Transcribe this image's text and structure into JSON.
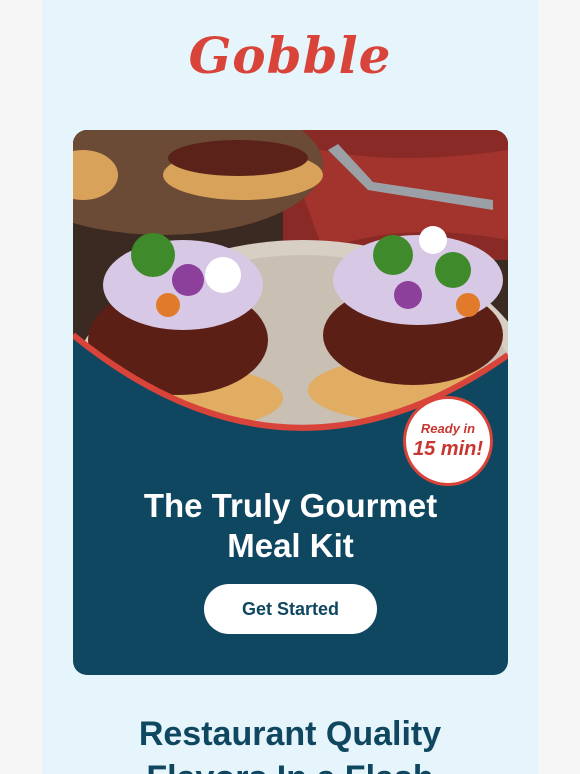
{
  "brand": {
    "logo_text": "Gobble"
  },
  "hero": {
    "image_alt": "Pulled beef with slaw on flatbreads",
    "badge": {
      "line1": "Ready in",
      "line2": "15 min!"
    },
    "headline_line1": "The Truly Gourmet",
    "headline_line2": "Meal Kit",
    "cta_label": "Get Started"
  },
  "section": {
    "subhead_line1": "Restaurant Quality",
    "subhead_line2": "Flavors In a Flash"
  },
  "colors": {
    "brand_red": "#d9443a",
    "navy": "#0f4761",
    "background": "#e6f4fb"
  }
}
